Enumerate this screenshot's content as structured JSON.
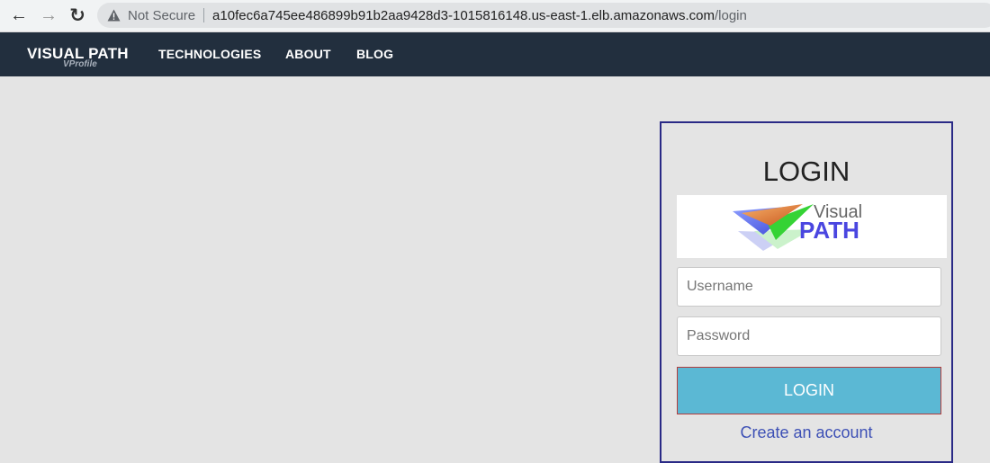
{
  "browser": {
    "back_icon": "←",
    "forward_icon": "→",
    "reload_icon": "↻",
    "security_label": "Not Secure",
    "url_host": "a10fec6a745ee486899b91b2aa9428d3-1015816148.us-east-1.elb.amazonaws.com",
    "url_path": "/login"
  },
  "navbar": {
    "brand": "VISUAL PATH",
    "brand_sub": "VProfile",
    "links": [
      "TECHNOLOGIES",
      "ABOUT",
      "BLOG"
    ],
    "background": "#222f3e"
  },
  "login": {
    "title": "LOGIN",
    "logo_text_top": "Visual",
    "logo_text_bottom": "PATH",
    "username_placeholder": "Username",
    "password_placeholder": "Password",
    "button_label": "LOGIN",
    "create_account": "Create an account",
    "accent_color": "#5bb8d4",
    "border_color": "#2a2a86"
  }
}
